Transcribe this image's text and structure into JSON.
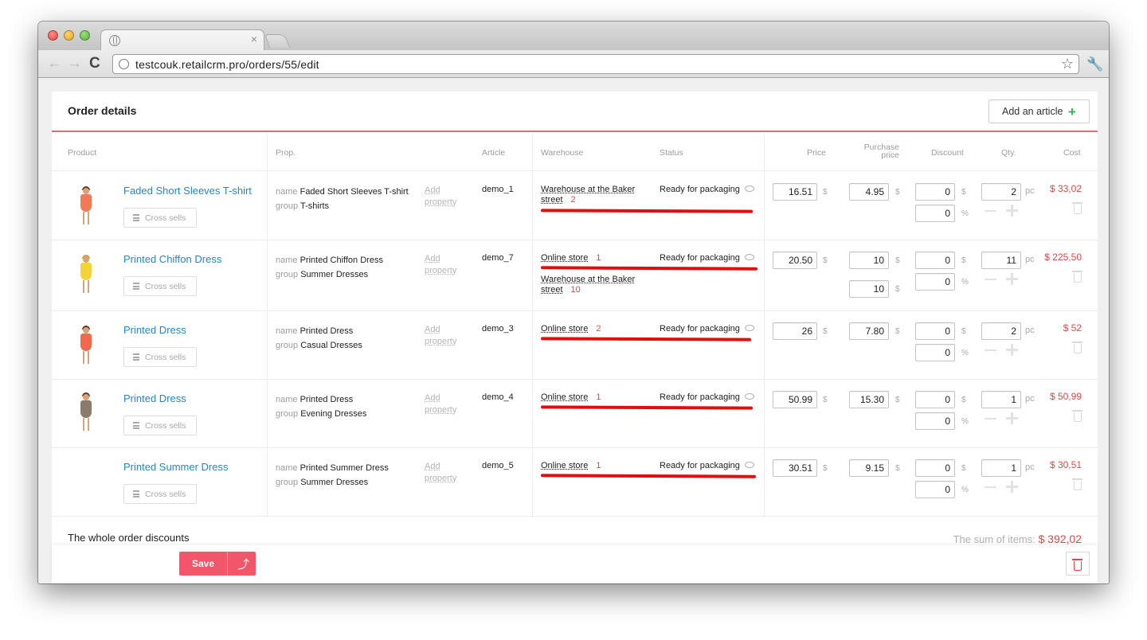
{
  "browser": {
    "url": "testcouk.retailcrm.pro/orders/55/edit",
    "tab_close": "×",
    "back": "←",
    "forward": "→",
    "reload": "C"
  },
  "order": {
    "title": "Order details",
    "add_article_label": "Add an article",
    "columns": {
      "product": "Product",
      "prop": "Prop.",
      "article": "Article",
      "warehouse": "Warehouse",
      "status": "Status",
      "price": "Price",
      "purchase_price_1": "Purchase",
      "purchase_price_2": "price",
      "discount": "Discount",
      "qty": "Qty.",
      "cost": "Cost"
    },
    "cross_sells_label": "Cross sells",
    "prop_name_key": "name",
    "prop_group_key": "group",
    "add_property_1": "Add",
    "add_property_2": "property",
    "currency_unit": "$",
    "percent_unit": "%",
    "qty_unit": "pc",
    "rows": [
      {
        "name": "Faded Short Sleeves T-shirt",
        "prop_name": "Faded Short Sleeves T-shirt",
        "prop_group": "T-shirts",
        "article": "demo_1",
        "status": "Ready for packaging",
        "warehouses": [
          {
            "name_1": "Warehouse at the Baker",
            "name_2": "street",
            "qty": "2"
          }
        ],
        "price": "16.51",
        "purchase": [
          "4.95"
        ],
        "discount": "0",
        "discount_pct": "0",
        "qty": "2",
        "cost": "$ 33,02"
      },
      {
        "name": "Printed Chiffon Dress",
        "prop_name": "Printed Chiffon Dress",
        "prop_group": "Summer Dresses",
        "article": "demo_7",
        "status": "Ready for packaging",
        "warehouses": [
          {
            "name_1": "Online store",
            "qty": "1"
          },
          {
            "name_1": "Warehouse at the Baker",
            "name_2": "street",
            "qty": "10"
          }
        ],
        "price": "20.50",
        "purchase": [
          "10",
          "10"
        ],
        "discount": "0",
        "discount_pct": "0",
        "qty": "11",
        "cost": "$ 225,50"
      },
      {
        "name": "Printed Dress",
        "prop_name": "Printed Dress",
        "prop_group": "Casual Dresses",
        "article": "demo_3",
        "status": "Ready for packaging",
        "warehouses": [
          {
            "name_1": "Online store",
            "qty": "2"
          }
        ],
        "price": "26",
        "purchase": [
          "7.80"
        ],
        "discount": "0",
        "discount_pct": "0",
        "qty": "2",
        "cost": "$ 52"
      },
      {
        "name": "Printed Dress",
        "prop_name": "Printed Dress",
        "prop_group": "Evening Dresses",
        "article": "demo_4",
        "status": "Ready for packaging",
        "warehouses": [
          {
            "name_1": "Online store",
            "qty": "1"
          }
        ],
        "price": "50.99",
        "purchase": [
          "15.30"
        ],
        "discount": "0",
        "discount_pct": "0",
        "qty": "1",
        "cost": "$ 50,99"
      },
      {
        "name": "Printed Summer Dress",
        "prop_name": "Printed Summer Dress",
        "prop_group": "Summer Dresses",
        "article": "demo_5",
        "status": "Ready for packaging",
        "warehouses": [
          {
            "name_1": "Online store",
            "qty": "1"
          }
        ],
        "price": "30.51",
        "purchase": [
          "9.15"
        ],
        "discount": "0",
        "discount_pct": "0",
        "qty": "1",
        "cost": "$ 30,51"
      }
    ],
    "whole_discounts_label": "The whole order discounts",
    "sum_label": "The sum of items:",
    "sum_value": "$ 392,02",
    "save_label": "Save"
  },
  "colors": {
    "accent": "#f2566b",
    "link": "#2a86c0",
    "cost": "#e04848",
    "highlight": "#e20d0d",
    "plus": "#2db84d"
  }
}
